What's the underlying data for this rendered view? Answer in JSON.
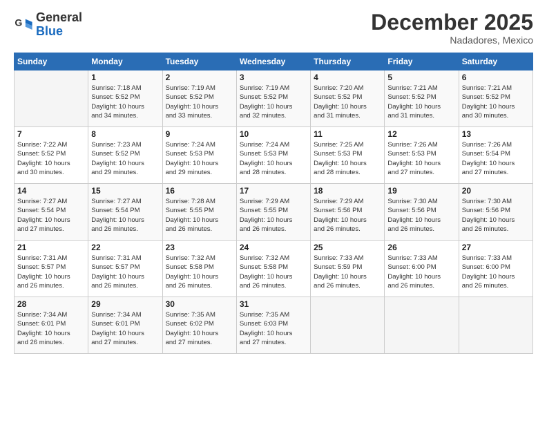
{
  "logo": {
    "line1": "General",
    "line2": "Blue"
  },
  "header": {
    "month": "December 2025",
    "location": "Nadadores, Mexico"
  },
  "weekdays": [
    "Sunday",
    "Monday",
    "Tuesday",
    "Wednesday",
    "Thursday",
    "Friday",
    "Saturday"
  ],
  "weeks": [
    [
      {
        "day": "",
        "info": ""
      },
      {
        "day": "1",
        "info": "Sunrise: 7:18 AM\nSunset: 5:52 PM\nDaylight: 10 hours\nand 34 minutes."
      },
      {
        "day": "2",
        "info": "Sunrise: 7:19 AM\nSunset: 5:52 PM\nDaylight: 10 hours\nand 33 minutes."
      },
      {
        "day": "3",
        "info": "Sunrise: 7:19 AM\nSunset: 5:52 PM\nDaylight: 10 hours\nand 32 minutes."
      },
      {
        "day": "4",
        "info": "Sunrise: 7:20 AM\nSunset: 5:52 PM\nDaylight: 10 hours\nand 31 minutes."
      },
      {
        "day": "5",
        "info": "Sunrise: 7:21 AM\nSunset: 5:52 PM\nDaylight: 10 hours\nand 31 minutes."
      },
      {
        "day": "6",
        "info": "Sunrise: 7:21 AM\nSunset: 5:52 PM\nDaylight: 10 hours\nand 30 minutes."
      }
    ],
    [
      {
        "day": "7",
        "info": "Sunrise: 7:22 AM\nSunset: 5:52 PM\nDaylight: 10 hours\nand 30 minutes."
      },
      {
        "day": "8",
        "info": "Sunrise: 7:23 AM\nSunset: 5:52 PM\nDaylight: 10 hours\nand 29 minutes."
      },
      {
        "day": "9",
        "info": "Sunrise: 7:24 AM\nSunset: 5:53 PM\nDaylight: 10 hours\nand 29 minutes."
      },
      {
        "day": "10",
        "info": "Sunrise: 7:24 AM\nSunset: 5:53 PM\nDaylight: 10 hours\nand 28 minutes."
      },
      {
        "day": "11",
        "info": "Sunrise: 7:25 AM\nSunset: 5:53 PM\nDaylight: 10 hours\nand 28 minutes."
      },
      {
        "day": "12",
        "info": "Sunrise: 7:26 AM\nSunset: 5:53 PM\nDaylight: 10 hours\nand 27 minutes."
      },
      {
        "day": "13",
        "info": "Sunrise: 7:26 AM\nSunset: 5:54 PM\nDaylight: 10 hours\nand 27 minutes."
      }
    ],
    [
      {
        "day": "14",
        "info": "Sunrise: 7:27 AM\nSunset: 5:54 PM\nDaylight: 10 hours\nand 27 minutes."
      },
      {
        "day": "15",
        "info": "Sunrise: 7:27 AM\nSunset: 5:54 PM\nDaylight: 10 hours\nand 26 minutes."
      },
      {
        "day": "16",
        "info": "Sunrise: 7:28 AM\nSunset: 5:55 PM\nDaylight: 10 hours\nand 26 minutes."
      },
      {
        "day": "17",
        "info": "Sunrise: 7:29 AM\nSunset: 5:55 PM\nDaylight: 10 hours\nand 26 minutes."
      },
      {
        "day": "18",
        "info": "Sunrise: 7:29 AM\nSunset: 5:56 PM\nDaylight: 10 hours\nand 26 minutes."
      },
      {
        "day": "19",
        "info": "Sunrise: 7:30 AM\nSunset: 5:56 PM\nDaylight: 10 hours\nand 26 minutes."
      },
      {
        "day": "20",
        "info": "Sunrise: 7:30 AM\nSunset: 5:56 PM\nDaylight: 10 hours\nand 26 minutes."
      }
    ],
    [
      {
        "day": "21",
        "info": "Sunrise: 7:31 AM\nSunset: 5:57 PM\nDaylight: 10 hours\nand 26 minutes."
      },
      {
        "day": "22",
        "info": "Sunrise: 7:31 AM\nSunset: 5:57 PM\nDaylight: 10 hours\nand 26 minutes."
      },
      {
        "day": "23",
        "info": "Sunrise: 7:32 AM\nSunset: 5:58 PM\nDaylight: 10 hours\nand 26 minutes."
      },
      {
        "day": "24",
        "info": "Sunrise: 7:32 AM\nSunset: 5:58 PM\nDaylight: 10 hours\nand 26 minutes."
      },
      {
        "day": "25",
        "info": "Sunrise: 7:33 AM\nSunset: 5:59 PM\nDaylight: 10 hours\nand 26 minutes."
      },
      {
        "day": "26",
        "info": "Sunrise: 7:33 AM\nSunset: 6:00 PM\nDaylight: 10 hours\nand 26 minutes."
      },
      {
        "day": "27",
        "info": "Sunrise: 7:33 AM\nSunset: 6:00 PM\nDaylight: 10 hours\nand 26 minutes."
      }
    ],
    [
      {
        "day": "28",
        "info": "Sunrise: 7:34 AM\nSunset: 6:01 PM\nDaylight: 10 hours\nand 26 minutes."
      },
      {
        "day": "29",
        "info": "Sunrise: 7:34 AM\nSunset: 6:01 PM\nDaylight: 10 hours\nand 27 minutes."
      },
      {
        "day": "30",
        "info": "Sunrise: 7:35 AM\nSunset: 6:02 PM\nDaylight: 10 hours\nand 27 minutes."
      },
      {
        "day": "31",
        "info": "Sunrise: 7:35 AM\nSunset: 6:03 PM\nDaylight: 10 hours\nand 27 minutes."
      },
      {
        "day": "",
        "info": ""
      },
      {
        "day": "",
        "info": ""
      },
      {
        "day": "",
        "info": ""
      }
    ]
  ]
}
